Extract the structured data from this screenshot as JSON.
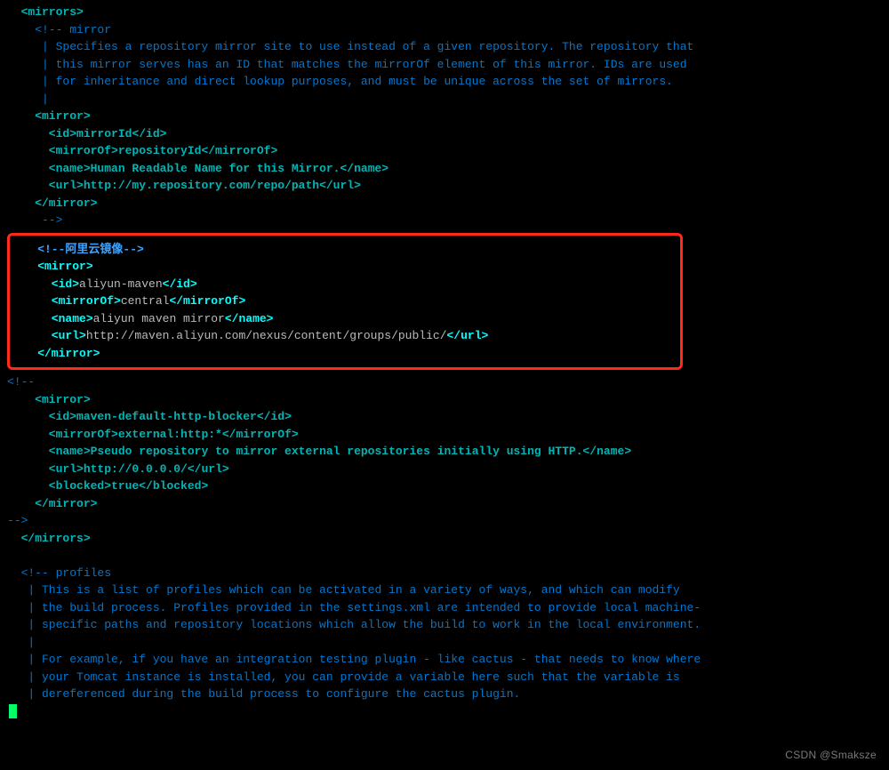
{
  "l01": "  <mirrors>",
  "l02": "    <!-- mirror",
  "l03": "     | Specifies a repository mirror site to use instead of a given repository. The repository that",
  "l04": "     | this mirror serves has an ID that matches the mirrorOf element of this mirror. IDs are used",
  "l05": "     | for inheritance and direct lookup purposes, and must be unique across the set of mirrors.",
  "l06": "     |",
  "l07a": "    <mirror>",
  "l07b": "      <id>",
  "l07b_v": "mirrorId",
  "l07b_c": "</id>",
  "l07c": "      <mirrorOf>",
  "l07c_v": "repositoryId",
  "l07c_c": "</mirrorOf>",
  "l07d": "      <name>",
  "l07d_v": "Human Readable Name for this Mirror.",
  "l07d_c": "</name>",
  "l07e": "      <url>",
  "l07e_v": "http://my.repository.com/repo/path",
  "l07e_c": "</url>",
  "l07f": "    </mirror>",
  "l07g": "     -->",
  "box_cmt": "    <!--阿里云镜像-->",
  "box_open": "    <mirror>",
  "box_id_o": "      <id>",
  "box_id_v": "aliyun-maven",
  "box_id_c": "</id>",
  "box_mo_o": "      <mirrorOf>",
  "box_mo_v": "central",
  "box_mo_c": "</mirrorOf>",
  "box_nm_o": "      <name>",
  "box_nm_v": "aliyun maven mirror",
  "box_nm_c": "</name>",
  "box_ur_o": "      <url>",
  "box_ur_v": "http://maven.aliyun.com/nexus/content/groups/public/",
  "box_ur_c": "</url>",
  "box_close": "    </mirror>",
  "c_open": "<!--",
  "m2_open": "    <mirror>",
  "m2_id_o": "      <id>",
  "m2_id_v": "maven-default-http-blocker",
  "m2_id_c": "</id>",
  "m2_mo_o": "      <mirrorOf>",
  "m2_mo_v": "external:http:*",
  "m2_mo_c": "</mirrorOf>",
  "m2_nm_o": "      <name>",
  "m2_nm_v": "Pseudo repository to mirror external repositories initially using HTTP.",
  "m2_nm_c": "</name>",
  "m2_ur_o": "      <url>",
  "m2_ur_v": "http://0.0.0.0/",
  "m2_ur_c": "</url>",
  "m2_bl_o": "      <blocked>",
  "m2_bl_v": "true",
  "m2_bl_c": "</blocked>",
  "m2_close": "    </mirror>",
  "c_close": "-->",
  "mirrors_close": "  </mirrors>",
  "p1": "  <!-- profiles",
  "p2": "   | This is a list of profiles which can be activated in a variety of ways, and which can modify",
  "p3": "   | the build process. Profiles provided in the settings.xml are intended to provide local machine-",
  "p4": "   | specific paths and repository locations which allow the build to work in the local environment.",
  "p5": "   |",
  "p6": "   | For example, if you have an integration testing plugin - like cactus - that needs to know where",
  "p7": "   | your Tomcat instance is installed, you can provide a variable here such that the variable is",
  "p8": "   | dereferenced during the build process to configure the cactus plugin.",
  "brand": "CSDN @Smaksze"
}
